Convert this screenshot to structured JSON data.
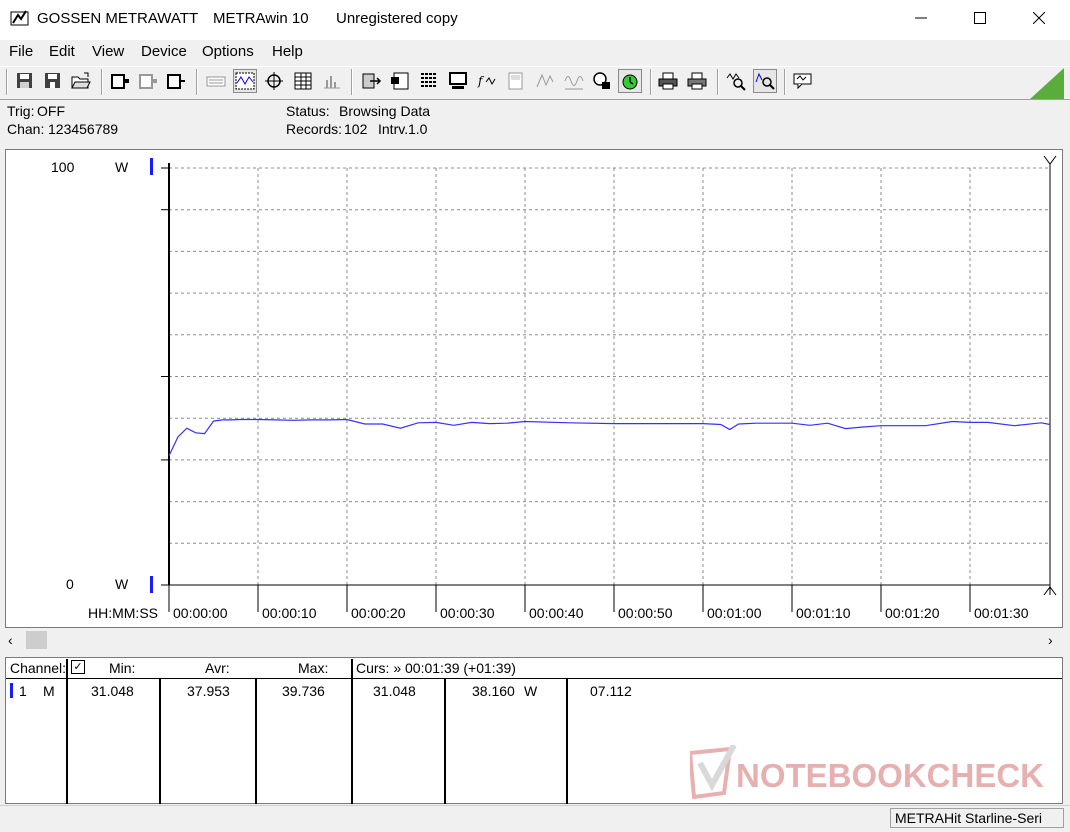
{
  "window": {
    "vendor": "GOSSEN METRAWATT",
    "app_name": "METRAwin 10",
    "license": "Unregistered copy",
    "controls": [
      "minimize",
      "maximize",
      "close"
    ]
  },
  "menu": [
    "File",
    "Edit",
    "View",
    "Device",
    "Options",
    "Help"
  ],
  "toolbar": {
    "icons": [
      "save-icon",
      "save-as-icon",
      "open-folder-icon",
      "device-connect-icon",
      "device-settings-icon",
      "device-read-icon",
      "keyboard-icon",
      "waveform-icon",
      "crosshair-icon",
      "table-view-icon",
      "bar-chart-icon",
      "export-icon",
      "print-preview-icon",
      "list-icon",
      "computer-icon",
      "function-icon",
      "meter-icon",
      "trigger-icon",
      "sine-icon",
      "record-icon",
      "stopwatch-icon",
      "printer-icon",
      "printer-setup-icon",
      "zoom-wave-icon",
      "zoom-cursor-icon",
      "help-icon"
    ]
  },
  "info": {
    "trig_label": "Trig:",
    "trig_value": "OFF",
    "chan_label": "Chan:",
    "chan_value": "123456789",
    "status_label": "Status:",
    "status_value": "Browsing Data",
    "records_label": "Records:",
    "records_value": "102",
    "interval_label": "Intrv.",
    "interval_value": "1.0"
  },
  "chart_data": {
    "type": "line",
    "y_top_label": "100",
    "y_bottom_label": "0",
    "y_unit_top": "W",
    "y_unit_bottom": "W",
    "ylim": [
      0,
      100
    ],
    "x_axis_caption": "HH:MM:SS",
    "x_tick_labels": [
      "00:00:00",
      "00:00:10",
      "00:00:20",
      "00:00:30",
      "00:00:40",
      "00:00:50",
      "00:01:00",
      "00:01:10",
      "00:01:20",
      "00:01:30"
    ],
    "xlim_seconds": [
      0,
      99
    ],
    "grid": true,
    "series": [
      {
        "channel": "1",
        "color": "#3333ff",
        "x": [
          0,
          1,
          2,
          3,
          4,
          5,
          6,
          7,
          8,
          10,
          12,
          14,
          16,
          18,
          20,
          22,
          24,
          26,
          28,
          30,
          32,
          34,
          36,
          38,
          40,
          45,
          50,
          55,
          60,
          62,
          63,
          64,
          66,
          68,
          70,
          72,
          74,
          76,
          78,
          80,
          85,
          88,
          90,
          92,
          95,
          98,
          99
        ],
        "y": [
          31.0,
          35.5,
          37.6,
          36.5,
          36.3,
          39.3,
          39.6,
          39.6,
          39.7,
          39.7,
          39.6,
          39.5,
          39.6,
          39.6,
          39.7,
          38.6,
          38.6,
          37.6,
          38.9,
          39.0,
          38.3,
          39.0,
          38.7,
          38.8,
          39.2,
          38.9,
          38.7,
          38.7,
          38.7,
          38.5,
          37.3,
          38.6,
          38.8,
          38.8,
          38.8,
          38.3,
          38.8,
          37.5,
          37.9,
          38.2,
          38.2,
          39.2,
          39.0,
          39.0,
          38.2,
          38.9,
          38.5
        ]
      }
    ]
  },
  "table": {
    "headers": {
      "channel": "Channel:",
      "min": "Min:",
      "avr": "Avr:",
      "max": "Max:",
      "cursor": "Curs: » 00:01:39 (+01:39)"
    },
    "row": {
      "channel_no": "1",
      "mode": "M",
      "min": "31.048",
      "avr": "37.953",
      "max": "39.736",
      "curs_value": "31.048",
      "current_value": "38.160",
      "unit": "W",
      "extra": "07.112"
    }
  },
  "statusbar": {
    "device": "METRAHit Starline-Seri"
  },
  "watermark": {
    "brand": "NOTEBOOKCHECK"
  }
}
